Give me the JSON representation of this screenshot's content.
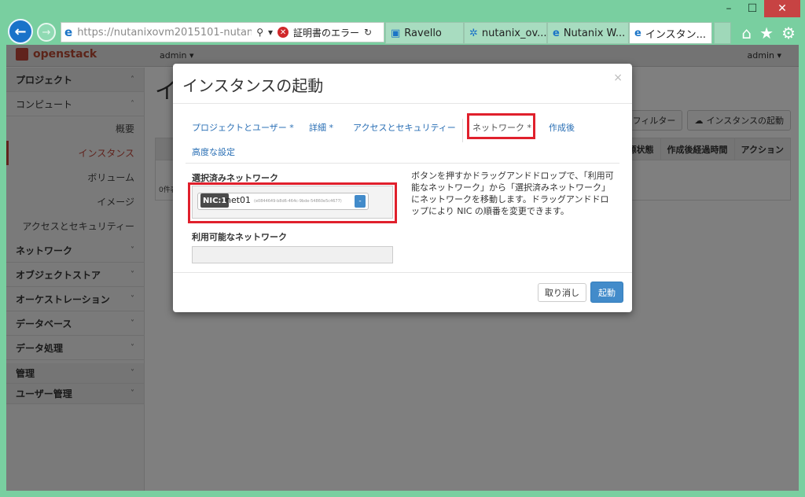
{
  "browser": {
    "url": "https://nutanixovm2015101-nutan...",
    "cert_error": "証明書のエラー",
    "tabs": [
      {
        "label": "Ravello",
        "icon": "ravello-icon"
      },
      {
        "label": "nutanix_ov...",
        "icon": "nutanix-icon"
      },
      {
        "label": "Nutanix W...",
        "icon": "ie-icon"
      },
      {
        "label": "インスタン...",
        "icon": "ie-icon",
        "active": true
      }
    ]
  },
  "topbar": {
    "logo": "openstack",
    "project": "admin ▾",
    "user": "admin ▾"
  },
  "sidebar": {
    "items": [
      {
        "label": "プロジェクト",
        "type": "head"
      },
      {
        "label": "コンピュート",
        "type": "group"
      },
      {
        "label": "概要",
        "type": "sub"
      },
      {
        "label": "インスタンス",
        "type": "sub",
        "active": true
      },
      {
        "label": "ボリューム",
        "type": "sub"
      },
      {
        "label": "イメージ",
        "type": "sub"
      },
      {
        "label": "アクセスとセキュリティー",
        "type": "sub"
      },
      {
        "label": "ネットワーク",
        "type": "group"
      },
      {
        "label": "オブジェクトストア",
        "type": "group"
      },
      {
        "label": "オーケストレーション",
        "type": "group"
      },
      {
        "label": "データベース",
        "type": "group"
      },
      {
        "label": "データ処理",
        "type": "group"
      },
      {
        "label": "管理",
        "type": "head"
      },
      {
        "label": "ユーザー管理",
        "type": "head"
      }
    ]
  },
  "background": {
    "title": "イ",
    "filter_button": "フィルター",
    "launch_button": "インスタンスの起動",
    "columns": [
      "電源状態",
      "作成後経過時間",
      "アクション"
    ],
    "count": "0件表"
  },
  "modal": {
    "title": "インスタンスの起動",
    "close": "×",
    "tabs": [
      "プロジェクトとユーザー *",
      "詳細 *",
      "アクセスとセキュリティー",
      "ネットワーク *",
      "作成後",
      "高度な設定"
    ],
    "selected_label": "選択済みネットワーク",
    "nic_label": "NIC:1",
    "network_name": "net01",
    "network_id": "(e0844649-b8d6-464c-9bde-54860e5c4677)",
    "remove_button": "-",
    "available_label": "利用可能なネットワーク",
    "help_text": "ボタンを押すかドラッグアンドドロップで、「利用可能なネットワーク」から「選択済みネットワーク」にネットワークを移動します。ドラッグアンドドロップにより NIC の順番を変更できます。",
    "cancel_button": "取り消し",
    "launch_button": "起動"
  }
}
